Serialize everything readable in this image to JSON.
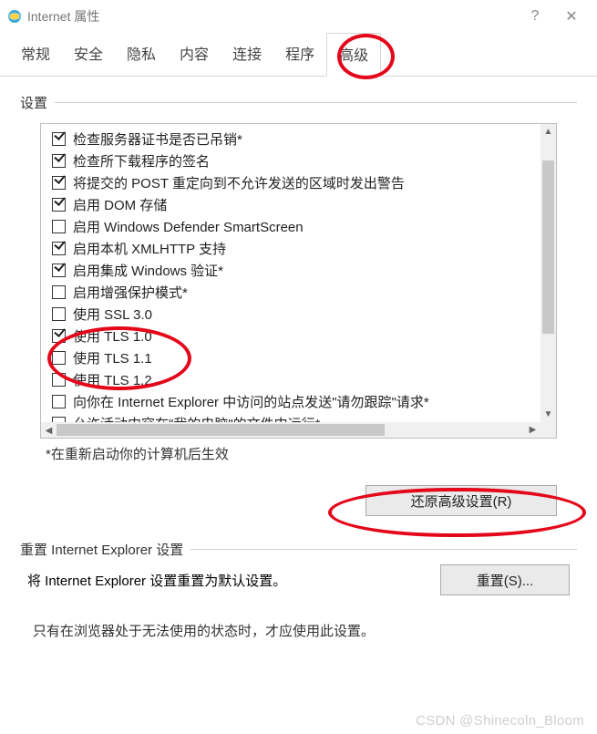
{
  "window": {
    "title": "Internet 属性",
    "help_glyph": "?",
    "close_glyph": "✕"
  },
  "tabs": [
    {
      "id": "general",
      "label": "常规",
      "active": false
    },
    {
      "id": "security",
      "label": "安全",
      "active": false
    },
    {
      "id": "privacy",
      "label": "隐私",
      "active": false
    },
    {
      "id": "content",
      "label": "内容",
      "active": false
    },
    {
      "id": "connections",
      "label": "连接",
      "active": false
    },
    {
      "id": "programs",
      "label": "程序",
      "active": false
    },
    {
      "id": "advanced",
      "label": "高级",
      "active": true
    }
  ],
  "advanced": {
    "group_label": "设置",
    "restart_note": "*在重新启动你的计算机后生效",
    "restore_button": "还原高级设置(R)",
    "items": [
      {
        "checked": true,
        "label": "检查服务器证书是否已吊销*"
      },
      {
        "checked": true,
        "label": "检查所下载程序的签名"
      },
      {
        "checked": true,
        "label": "将提交的 POST 重定向到不允许发送的区域时发出警告"
      },
      {
        "checked": true,
        "label": "启用 DOM 存储"
      },
      {
        "checked": false,
        "label": "启用 Windows Defender SmartScreen"
      },
      {
        "checked": true,
        "label": "启用本机 XMLHTTP 支持"
      },
      {
        "checked": true,
        "label": "启用集成 Windows 验证*"
      },
      {
        "checked": false,
        "label": "启用增强保护模式*"
      },
      {
        "checked": false,
        "label": "使用 SSL 3.0"
      },
      {
        "checked": true,
        "label": "使用 TLS 1.0"
      },
      {
        "checked": false,
        "label": "使用 TLS 1.1"
      },
      {
        "checked": false,
        "label": "使用 TLS 1.2"
      },
      {
        "checked": false,
        "label": "向你在 Internet Explorer 中访问的站点发送\"请勿跟踪\"请求*"
      },
      {
        "checked": false,
        "label": "允许活动内容在\"我的电脑\"的文件中运行*"
      }
    ]
  },
  "reset": {
    "group_label": "重置 Internet Explorer 设置",
    "desc": "将 Internet Explorer 设置重置为默认设置。",
    "button": "重置(S)...",
    "note": "只有在浏览器处于无法使用的状态时，才应使用此设置。"
  },
  "watermark": "CSDN @Shinecoln_Bloom"
}
